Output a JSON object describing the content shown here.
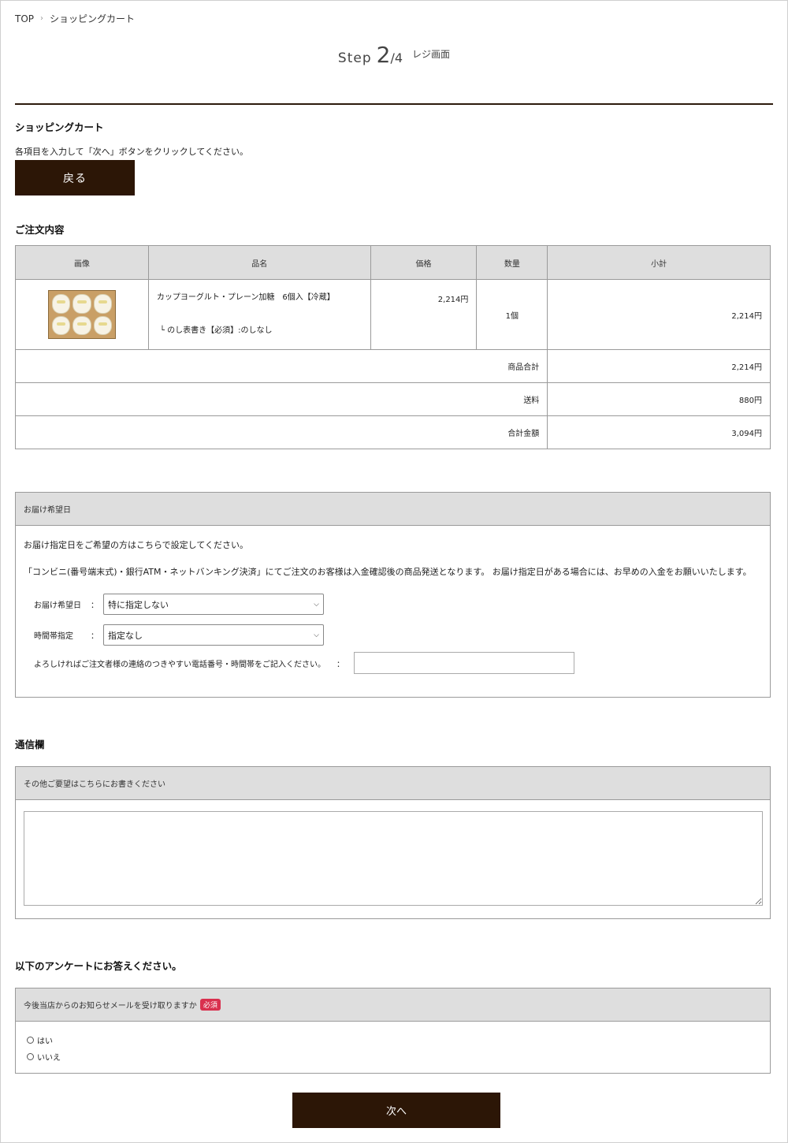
{
  "breadcrumb": {
    "home": "TOP",
    "separator": "›",
    "current": "ショッピングカート"
  },
  "step": {
    "word": "Step",
    "current": "2",
    "total": "/4",
    "label": "レジ画面"
  },
  "cart": {
    "title": "ショッピングカート",
    "instruction": "各項目を入力して「次へ」ボタンをクリックしてください。",
    "back_label": "戻る"
  },
  "order": {
    "title": "ご注文内容",
    "headers": [
      "画像",
      "品名",
      "価格",
      "数量",
      "小計"
    ],
    "item": {
      "name": "カップヨーグルト・プレーン加糖　6個入【冷蔵】",
      "noshi": "└ のし表書き【必須】:のしなし",
      "price": "2,214円",
      "qty": "1個",
      "subtotal": "2,214円"
    },
    "summary": [
      {
        "label": "商品合計",
        "value": "2,214円"
      },
      {
        "label": "送料",
        "value": "880円"
      },
      {
        "label": "合計金額",
        "value": "3,094円"
      }
    ]
  },
  "delivery": {
    "header": "お届け希望日",
    "note1": "お届け指定日をご希望の方はこちらで設定してください。",
    "note2": "「コンビニ(番号端末式)・銀行ATM・ネットバンキング決済」にてご注文のお客様は入金確認後の商品発送となります。 お届け指定日がある場合には、お早めの入金をお願いいたします。",
    "date_label": "お届け希望日",
    "date_value": "特に指定しない",
    "time_label": "時間帯指定",
    "time_value": "指定なし",
    "contact_label": "よろしければご注文者様の連絡のつきやすい電話番号・時間帯をご記入ください。",
    "colon": "："
  },
  "comm": {
    "title": "通信欄",
    "header": "その他ご要望はこちらにお書きください"
  },
  "survey": {
    "title": "以下のアンケートにお答えください。",
    "question": "今後当店からのお知らせメールを受け取りますか",
    "required": "必須",
    "options": [
      "はい",
      "いいえ"
    ]
  },
  "next_label": "次へ",
  "colors": {
    "accent_dark": "#2c1606",
    "required_badge": "#d9304e",
    "header_bg": "#dedede"
  }
}
